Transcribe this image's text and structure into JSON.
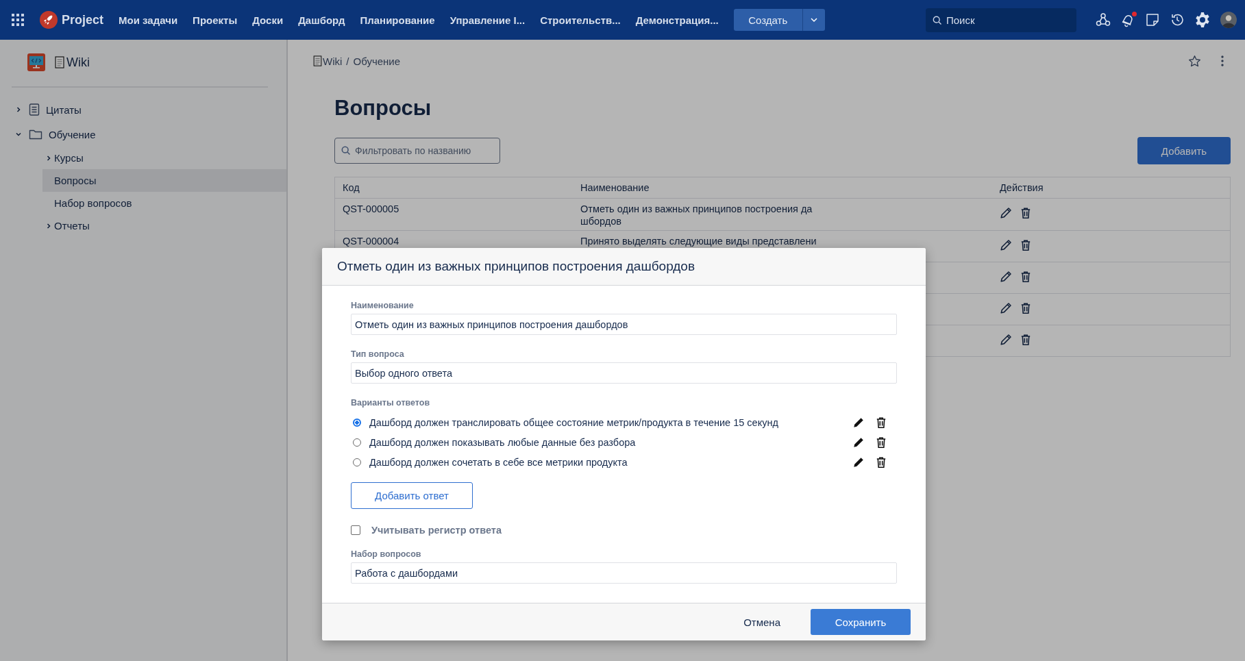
{
  "topbar": {
    "app_name": "Project",
    "nav": [
      "Мои задачи",
      "Проекты",
      "Доски",
      "Дашборд",
      "Планирование",
      "Управление I...",
      "Строительств...",
      "Демонстрация..."
    ],
    "create_button": "Создать",
    "search": {
      "placeholder": "Поиск"
    },
    "has_notifications": true
  },
  "sidebar": {
    "space_title": "Wiki",
    "tree": [
      {
        "label": "Цитаты",
        "kind": "page",
        "expanded": false,
        "selected": false
      },
      {
        "label": "Обучение",
        "kind": "folder",
        "expanded": true,
        "selected": false,
        "children": [
          {
            "label": "Курсы",
            "expanded": false,
            "selected": false
          },
          {
            "label": "Вопросы",
            "selected": true
          },
          {
            "label": "Набор вопросов",
            "selected": false
          },
          {
            "label": "Отчеты",
            "expanded": false,
            "selected": false
          }
        ]
      }
    ]
  },
  "breadcrumb": [
    "Wiki",
    "Обучение"
  ],
  "breadcrumb_separator": "/",
  "page_title": "Вопросы",
  "filter": {
    "placeholder": "Фильтровать по названию"
  },
  "add_button": "Добавить",
  "table": {
    "columns": [
      "Код",
      "Наименование",
      "Действия"
    ],
    "rows": [
      {
        "covered": false,
        "code": "QST-000005",
        "name": "Отметь один из важных принципов построения дашбордов"
      },
      {
        "covered": false,
        "code": "QST-000004",
        "name": "Принято выделять следующие виды представлени"
      },
      {
        "covered": true
      },
      {
        "covered": true
      },
      {
        "covered": true
      }
    ]
  },
  "modal": {
    "title": "Отметь один из важных принципов построения дашбордов",
    "fields": [
      {
        "label": "Наименование",
        "value": "Отметь один из важных принципов построения дашбордов"
      },
      {
        "label": "Тип вопроса",
        "value": "Выбор одного ответа"
      }
    ],
    "answers_label": "Варианты ответов",
    "answers": [
      {
        "text": "Дашборд должен транслировать общее состояние метрик/продукта в течение 15 секунд",
        "selected": true
      },
      {
        "text": "Дашборд должен показывать любые данные без разбора",
        "selected": false
      },
      {
        "text": "Дашборд должен сочетать в себе все метрики продукта",
        "selected": false
      }
    ],
    "add_answer_button": "Добавить ответ",
    "case_sensitive": {
      "label": "Учитывать регистр ответа",
      "checked": false
    },
    "set_field": {
      "label": "Набор вопросов",
      "value": "Работа с дашбордами"
    },
    "cancel_button": "Отмена",
    "save_button": "Сохранить"
  }
}
